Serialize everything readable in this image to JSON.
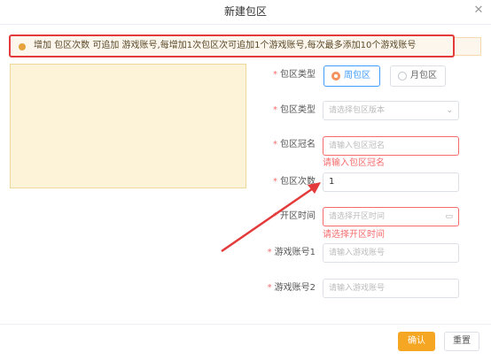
{
  "dialog": {
    "title": "新建包区"
  },
  "notice": {
    "text": "增加 包区次数 可追加 游戏账号,每增加1次包区次可追加1个游戏账号,每次最多添加10个游戏账号"
  },
  "form": {
    "mode": {
      "label": "包区类型",
      "options": [
        {
          "label": "周包区",
          "selected": true
        },
        {
          "label": "月包区",
          "selected": false
        }
      ]
    },
    "version": {
      "label": "包区类型",
      "placeholder": "请选择包区版本"
    },
    "name": {
      "label": "包区冠名",
      "placeholder": "请输入包区冠名",
      "error": "请输入包区冠名"
    },
    "count": {
      "label": "包区次数",
      "value": "1"
    },
    "open_time": {
      "label": "开区时间",
      "placeholder": "请选择开区时间",
      "error": "请选择开区时间"
    },
    "account1": {
      "label": "游戏账号1",
      "placeholder": "请输入游戏账号"
    },
    "account2": {
      "label": "游戏账号2",
      "placeholder": "请输入游戏账号"
    }
  },
  "footer": {
    "confirm": "确认",
    "reset": "重置"
  },
  "colors": {
    "accent": "#f5a623",
    "error": "#f56c6c",
    "highlight": "#e33b3b"
  }
}
